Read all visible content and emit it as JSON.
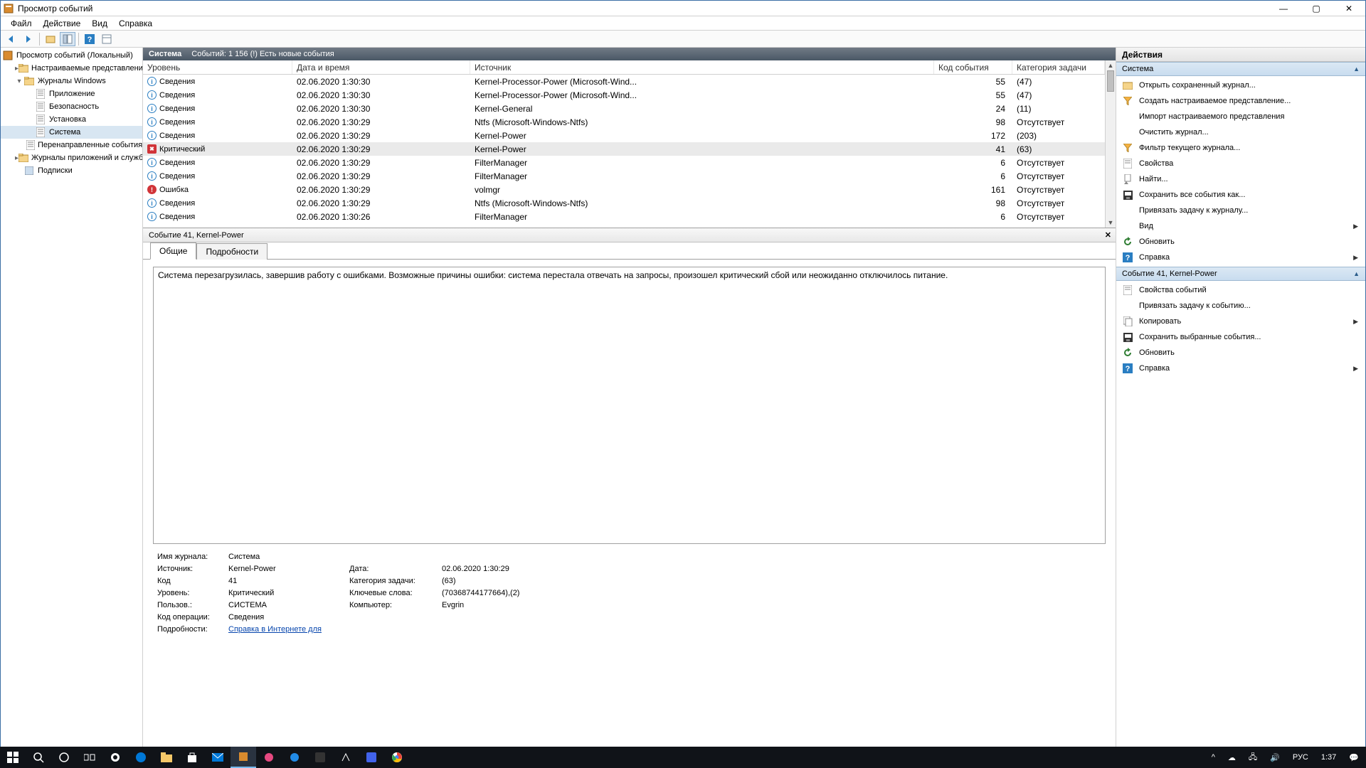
{
  "window": {
    "title": "Просмотр событий"
  },
  "menubar": [
    "Файл",
    "Действие",
    "Вид",
    "Справка"
  ],
  "tree": {
    "root": "Просмотр событий (Локальный)",
    "items": [
      {
        "label": "Настраиваемые представления",
        "indent": 1,
        "expand": ">",
        "icon": "folder"
      },
      {
        "label": "Журналы Windows",
        "indent": 1,
        "expand": "v",
        "icon": "folder"
      },
      {
        "label": "Приложение",
        "indent": 2,
        "expand": "",
        "icon": "log"
      },
      {
        "label": "Безопасность",
        "indent": 2,
        "expand": "",
        "icon": "log"
      },
      {
        "label": "Установка",
        "indent": 2,
        "expand": "",
        "icon": "log"
      },
      {
        "label": "Система",
        "indent": 2,
        "expand": "",
        "icon": "log",
        "selected": true
      },
      {
        "label": "Перенаправленные события",
        "indent": 2,
        "expand": "",
        "icon": "log"
      },
      {
        "label": "Журналы приложений и служб",
        "indent": 1,
        "expand": ">",
        "icon": "folder"
      },
      {
        "label": "Подписки",
        "indent": 1,
        "expand": "",
        "icon": "sub"
      }
    ]
  },
  "centerHeader": {
    "name": "Система",
    "info": "Событий: 1 156 (!) Есть новые события"
  },
  "columns": {
    "level": "Уровень",
    "datetime": "Дата и время",
    "source": "Источник",
    "code": "Код события",
    "cat": "Категория задачи"
  },
  "rows": [
    {
      "lvl": "info",
      "level": "Сведения",
      "dt": "02.06.2020 1:30:30",
      "src": "Kernel-Processor-Power (Microsoft-Wind...",
      "code": "55",
      "cat": "(47)"
    },
    {
      "lvl": "info",
      "level": "Сведения",
      "dt": "02.06.2020 1:30:30",
      "src": "Kernel-Processor-Power (Microsoft-Wind...",
      "code": "55",
      "cat": "(47)"
    },
    {
      "lvl": "info",
      "level": "Сведения",
      "dt": "02.06.2020 1:30:30",
      "src": "Kernel-General",
      "code": "24",
      "cat": "(11)"
    },
    {
      "lvl": "info",
      "level": "Сведения",
      "dt": "02.06.2020 1:30:29",
      "src": "Ntfs (Microsoft-Windows-Ntfs)",
      "code": "98",
      "cat": "Отсутствует"
    },
    {
      "lvl": "info",
      "level": "Сведения",
      "dt": "02.06.2020 1:30:29",
      "src": "Kernel-Power",
      "code": "172",
      "cat": "(203)"
    },
    {
      "lvl": "crit",
      "level": "Критический",
      "dt": "02.06.2020 1:30:29",
      "src": "Kernel-Power",
      "code": "41",
      "cat": "(63)",
      "selected": true
    },
    {
      "lvl": "info",
      "level": "Сведения",
      "dt": "02.06.2020 1:30:29",
      "src": "FilterManager",
      "code": "6",
      "cat": "Отсутствует"
    },
    {
      "lvl": "info",
      "level": "Сведения",
      "dt": "02.06.2020 1:30:29",
      "src": "FilterManager",
      "code": "6",
      "cat": "Отсутствует"
    },
    {
      "lvl": "err",
      "level": "Ошибка",
      "dt": "02.06.2020 1:30:29",
      "src": "volmgr",
      "code": "161",
      "cat": "Отсутствует"
    },
    {
      "lvl": "info",
      "level": "Сведения",
      "dt": "02.06.2020 1:30:29",
      "src": "Ntfs (Microsoft-Windows-Ntfs)",
      "code": "98",
      "cat": "Отсутствует"
    },
    {
      "lvl": "info",
      "level": "Сведения",
      "dt": "02.06.2020 1:30:26",
      "src": "FilterManager",
      "code": "6",
      "cat": "Отсутствует"
    }
  ],
  "detail": {
    "title": "Событие 41, Kernel-Power",
    "tabs": {
      "general": "Общие",
      "details": "Подробности"
    },
    "message": "Система перезагрузилась, завершив работу с ошибками. Возможные причины ошибки: система перестала отвечать на запросы, произошел критический сбой или неожиданно отключилось питание.",
    "props": {
      "logname_l": "Имя журнала:",
      "logname_v": "Система",
      "source_l": "Источник:",
      "source_v": "Kernel-Power",
      "date_l": "Дата:",
      "date_v": "02.06.2020 1:30:29",
      "code_l": "Код",
      "code_v": "41",
      "cat_l": "Категория задачи:",
      "cat_v": "(63)",
      "level_l": "Уровень:",
      "level_v": "Критический",
      "kw_l": "Ключевые слова:",
      "kw_v": "(70368744177664),(2)",
      "user_l": "Пользов.:",
      "user_v": "СИСТЕМА",
      "comp_l": "Компьютер:",
      "comp_v": "Evgrin",
      "op_l": "Код операции:",
      "op_v": "Сведения",
      "more_l": "Подробности:",
      "more_v": "Справка в Интернете для"
    }
  },
  "actions": {
    "title": "Действия",
    "section1": "Система",
    "list1": [
      {
        "icon": "open",
        "label": "Открыть сохраненный журнал..."
      },
      {
        "icon": "filter",
        "label": "Создать настраиваемое представление..."
      },
      {
        "icon": "",
        "label": "Импорт настраиваемого представления"
      },
      {
        "icon": "",
        "label": "Очистить журнал..."
      },
      {
        "icon": "filter",
        "label": "Фильтр текущего журнала..."
      },
      {
        "icon": "prop",
        "label": "Свойства"
      },
      {
        "icon": "find",
        "label": "Найти..."
      },
      {
        "icon": "save",
        "label": "Сохранить все события как..."
      },
      {
        "icon": "",
        "label": "Привязать задачу к журналу..."
      },
      {
        "icon": "",
        "label": "Вид",
        "arrow": true
      },
      {
        "icon": "refresh",
        "label": "Обновить"
      },
      {
        "icon": "help",
        "label": "Справка",
        "arrow": true
      }
    ],
    "section2": "Событие 41, Kernel-Power",
    "list2": [
      {
        "icon": "prop",
        "label": "Свойства событий"
      },
      {
        "icon": "",
        "label": "Привязать задачу к событию..."
      },
      {
        "icon": "copy",
        "label": "Копировать",
        "arrow": true
      },
      {
        "icon": "save",
        "label": "Сохранить выбранные события..."
      },
      {
        "icon": "refresh",
        "label": "Обновить"
      },
      {
        "icon": "help",
        "label": "Справка",
        "arrow": true
      }
    ]
  },
  "taskbar": {
    "lang": "РУС",
    "time": "1:37"
  }
}
